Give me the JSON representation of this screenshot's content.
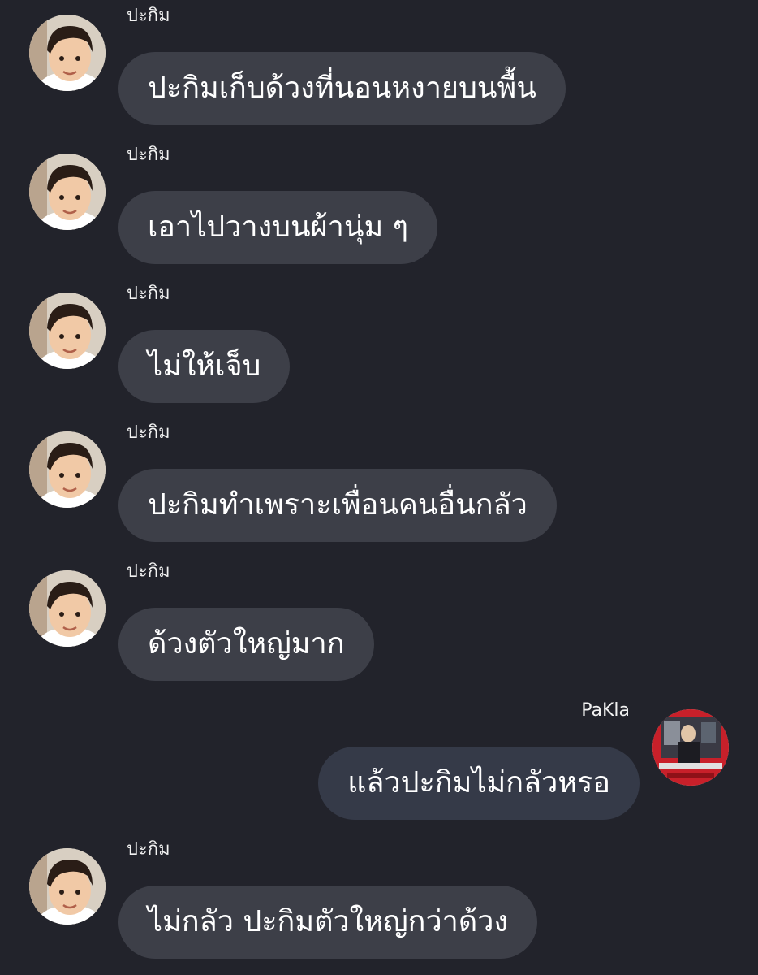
{
  "colors": {
    "background": "#22232b",
    "incoming_bubble": "#3d3f48",
    "outgoing_bubble": "#353a48",
    "text": "#ffffff"
  },
  "messages": [
    {
      "sender": "ปะกิม",
      "text": "ปะกิมเก็บด้วงที่นอนหงายบนพื้น",
      "direction": "incoming",
      "avatar_icon": "child-avatar-icon"
    },
    {
      "sender": "ปะกิม",
      "text": "เอาไปวางบนผ้านุ่ม ๆ",
      "direction": "incoming",
      "avatar_icon": "child-avatar-icon"
    },
    {
      "sender": "ปะกิม",
      "text": "ไม่ให้เจ็บ",
      "direction": "incoming",
      "avatar_icon": "child-avatar-icon"
    },
    {
      "sender": "ปะกิม",
      "text": "ปะกิมทำเพราะเพื่อนคนอื่นกลัว",
      "direction": "incoming",
      "avatar_icon": "child-avatar-icon"
    },
    {
      "sender": "ปะกิม",
      "text": "ด้วงตัวใหญ่มาก",
      "direction": "incoming",
      "avatar_icon": "child-avatar-icon"
    },
    {
      "sender": "PaKla",
      "text": "แล้วปะกิมไม่กลัวหรอ",
      "direction": "outgoing",
      "avatar_icon": "photo-avatar-icon"
    },
    {
      "sender": "ปะกิม",
      "text": "ไม่กลัว ปะกิมตัวใหญ่กว่าด้วง",
      "direction": "incoming",
      "avatar_icon": "child-avatar-icon"
    }
  ]
}
